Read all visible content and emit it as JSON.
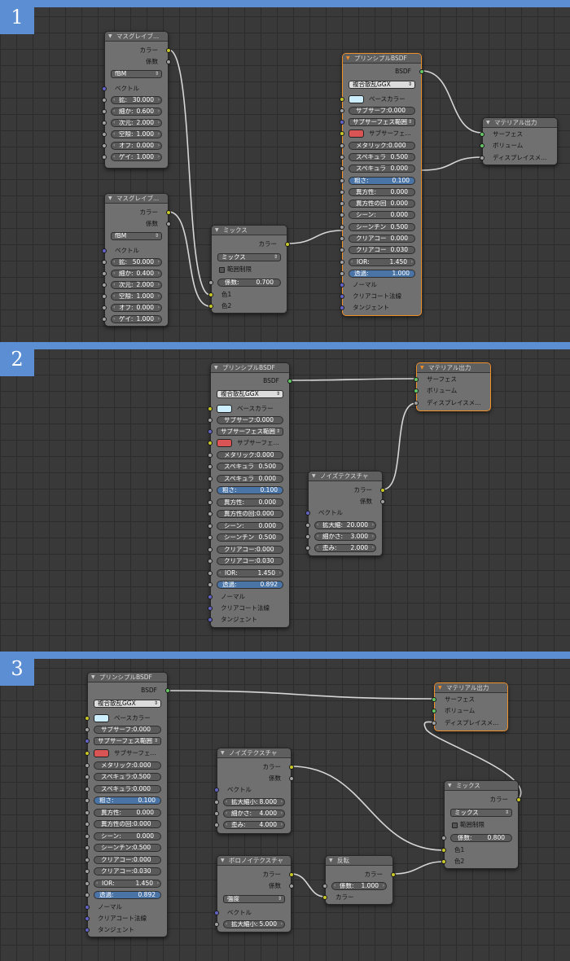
{
  "panels": [
    {
      "number": "1",
      "nodes": {
        "musgrave1": {
          "title": "マスグレイブ...",
          "out_color": "カラー",
          "out_factor": "係数",
          "type": "fBM",
          "vector": "ベクトル",
          "fields": [
            {
              "k": "拡:",
              "v": "30.000"
            },
            {
              "k": "細か:",
              "v": "0.600"
            },
            {
              "k": "次元:",
              "v": "2.000"
            },
            {
              "k": "空隙:",
              "v": "1.000"
            },
            {
              "k": "オフ:",
              "v": "0.000"
            },
            {
              "k": "ゲイ:",
              "v": "1.000"
            }
          ]
        },
        "musgrave2": {
          "title": "マスグレイブ...",
          "out_color": "カラー",
          "out_factor": "係数",
          "type": "fBM",
          "vector": "ベクトル",
          "fields": [
            {
              "k": "拡:",
              "v": "50.000"
            },
            {
              "k": "細か:",
              "v": "0.400"
            },
            {
              "k": "次元:",
              "v": "2.000"
            },
            {
              "k": "空隙:",
              "v": "1.000"
            },
            {
              "k": "オフ:",
              "v": "0.000"
            },
            {
              "k": "ゲイ:",
              "v": "1.000"
            }
          ]
        },
        "mix": {
          "title": "ミックス",
          "out_color": "カラー",
          "blend": "ミックス",
          "clamp": "範囲制限",
          "factor_k": "係数:",
          "factor_v": "0.700",
          "color1": "色1",
          "color2": "色2"
        },
        "bsdf": {
          "title": "プリンシプルBSDF",
          "out": "BSDF",
          "distribution": "複合散乱GGX",
          "base_color": "ベースカラー",
          "subsurface": "サブサーフ:0.000",
          "subsurface_method": "サブサーフェス範囲",
          "subsurface_color": "サブサーフェ...",
          "fields": [
            {
              "k": "メタリック:0.000",
              "v": ""
            },
            {
              "k": "スペキュラ",
              "v": "0.500"
            },
            {
              "k": "スペキュラ",
              "v": "0.000"
            },
            {
              "k": "粗さ:",
              "v": "0.100"
            },
            {
              "k": "異方性:",
              "v": "0.000"
            },
            {
              "k": "異方性の回",
              "v": "0.000"
            },
            {
              "k": "シーン:",
              "v": "0.000"
            },
            {
              "k": "シーンチン",
              "v": "0.500"
            },
            {
              "k": "クリアコー",
              "v": "0.000"
            },
            {
              "k": "クリアコー",
              "v": "0.030"
            },
            {
              "k": "IOR:",
              "v": "1.450"
            },
            {
              "k": "透過:",
              "v": "1.000"
            }
          ],
          "normal": "ノーマル",
          "clearcoat_normal": "クリアコート法線",
          "tangent": "タンジェント"
        },
        "output": {
          "title": "マテリアル出力",
          "surface": "サーフェス",
          "volume": "ボリューム",
          "displacement": "ディスプレイスメ..."
        }
      }
    },
    {
      "number": "2",
      "nodes": {
        "bsdf": {
          "title": "プリンシプルBSDF",
          "out": "BSDF",
          "distribution": "複合散乱GGX",
          "base_color": "ベースカラー",
          "subsurface": "サブサーフ:0.000",
          "subsurface_method": "サブサーフェス範囲",
          "subsurface_color": "サブサーフェ...",
          "fields": [
            {
              "k": "メタリック:0.000",
              "v": ""
            },
            {
              "k": "スペキュラ",
              "v": "0.500"
            },
            {
              "k": "スペキュラ",
              "v": "0.000"
            },
            {
              "k": "粗さ:",
              "v": "0.100"
            },
            {
              "k": "異方性:",
              "v": "0.000"
            },
            {
              "k": "異方性の回:0.000",
              "v": ""
            },
            {
              "k": "シーン:",
              "v": "0.000"
            },
            {
              "k": "シーンチン",
              "v": "0.500"
            },
            {
              "k": "クリアコー:0.000",
              "v": ""
            },
            {
              "k": "クリアコー:0.030",
              "v": ""
            },
            {
              "k": "IOR:",
              "v": "1.450"
            },
            {
              "k": "透過:",
              "v": "0.892"
            }
          ],
          "normal": "ノーマル",
          "clearcoat_normal": "クリアコート法線",
          "tangent": "タンジェント"
        },
        "output": {
          "title": "マテリアル出力",
          "surface": "サーフェス",
          "volume": "ボリューム",
          "displacement": "ディスプレイスメ..."
        },
        "noise": {
          "title": "ノイズテクスチャ",
          "out_color": "カラー",
          "out_factor": "係数",
          "vector": "ベクトル",
          "fields": [
            {
              "k": "拡大縮:",
              "v": "20.000"
            },
            {
              "k": "細かさ:",
              "v": "3.000"
            },
            {
              "k": "歪み:",
              "v": "2.000"
            }
          ]
        }
      }
    },
    {
      "number": "3",
      "nodes": {
        "bsdf": {
          "title": "プリンシプルBSDF",
          "out": "BSDF",
          "distribution": "複合散乱GGX",
          "base_color": "ベースカラー",
          "subsurface": "サブサーフ:0.000",
          "subsurface_method": "サブサーフェス範囲",
          "subsurface_color": "サブサーフェ...",
          "fields": [
            {
              "k": "メタリック:0.000",
              "v": ""
            },
            {
              "k": "スペキュラ:0.500",
              "v": ""
            },
            {
              "k": "スペキュラ:0.000",
              "v": ""
            },
            {
              "k": "粗さ:",
              "v": "0.100"
            },
            {
              "k": "異方性:",
              "v": "0.000"
            },
            {
              "k": "異方性の回:0.000",
              "v": ""
            },
            {
              "k": "シーン:",
              "v": "0.000"
            },
            {
              "k": "シーンチン:0.500",
              "v": ""
            },
            {
              "k": "クリアコー:0.000",
              "v": ""
            },
            {
              "k": "クリアコー:0.030",
              "v": ""
            },
            {
              "k": "IOR:",
              "v": "1.450"
            },
            {
              "k": "透過:",
              "v": "0.892"
            }
          ],
          "normal": "ノーマル",
          "clearcoat_normal": "クリアコート法線",
          "tangent": "タンジェント"
        },
        "output": {
          "title": "マテリアル出力",
          "surface": "サーフェス",
          "volume": "ボリューム",
          "displacement": "ディスプレイスメ..."
        },
        "noise": {
          "title": "ノイズテクスチャ",
          "out_color": "カラー",
          "out_factor": "係数",
          "vector": "ベクトル",
          "fields": [
            {
              "k": "拡大縮小:",
              "v": "8.000"
            },
            {
              "k": "細かさ:",
              "v": "4.000"
            },
            {
              "k": "歪み:",
              "v": "4.000"
            }
          ]
        },
        "mix": {
          "title": "ミックス",
          "out_color": "カラー",
          "blend": "ミックス",
          "clamp": "範囲制限",
          "factor_k": "係数:",
          "factor_v": "0.800",
          "color1": "色1",
          "color2": "色2"
        },
        "voronoi": {
          "title": "ボロノイテクスチャ",
          "out_color": "カラー",
          "out_factor": "係数",
          "coloring": "強度",
          "vector": "ベクトル",
          "scale_k": "拡大縮小:",
          "scale_v": "5.000"
        },
        "invert": {
          "title": "反転",
          "out_color": "カラー",
          "factor_k": "係数:",
          "factor_v": "1.000",
          "in_color": "カラー"
        }
      }
    }
  ]
}
